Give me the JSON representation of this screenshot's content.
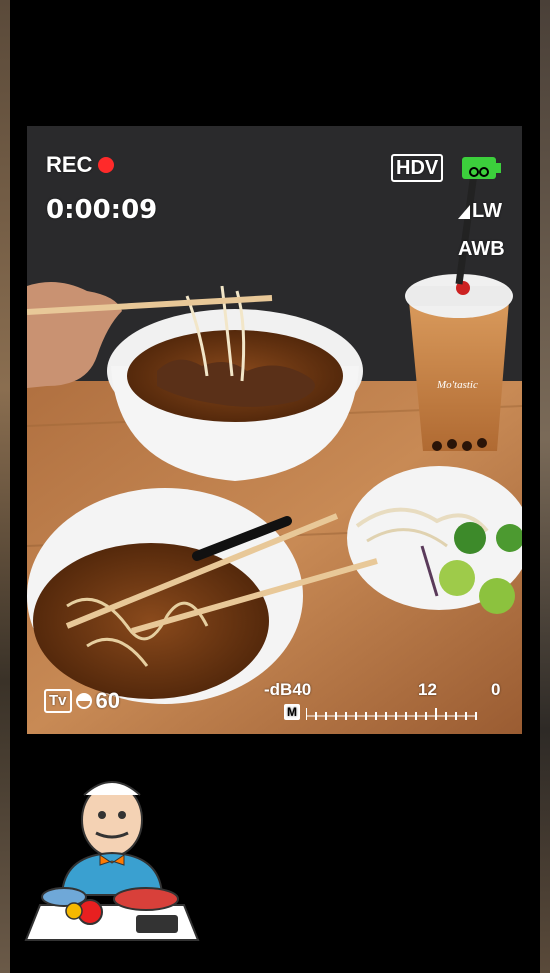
{
  "hud": {
    "rec_label": "REC",
    "timecode": "0:00:09",
    "format_badge": "HDV",
    "wb_mode": "LW",
    "awb_label": "AWB",
    "tv_label": "Tv",
    "shutter_value": "60",
    "db_label": "-dB40",
    "db_mid": "12",
    "db_max": "0",
    "meter_badge": "M"
  },
  "colors": {
    "rec_dot": "#ff2a2a",
    "battery": "#3ccf3c"
  },
  "cup_text": "Mo'tastic"
}
